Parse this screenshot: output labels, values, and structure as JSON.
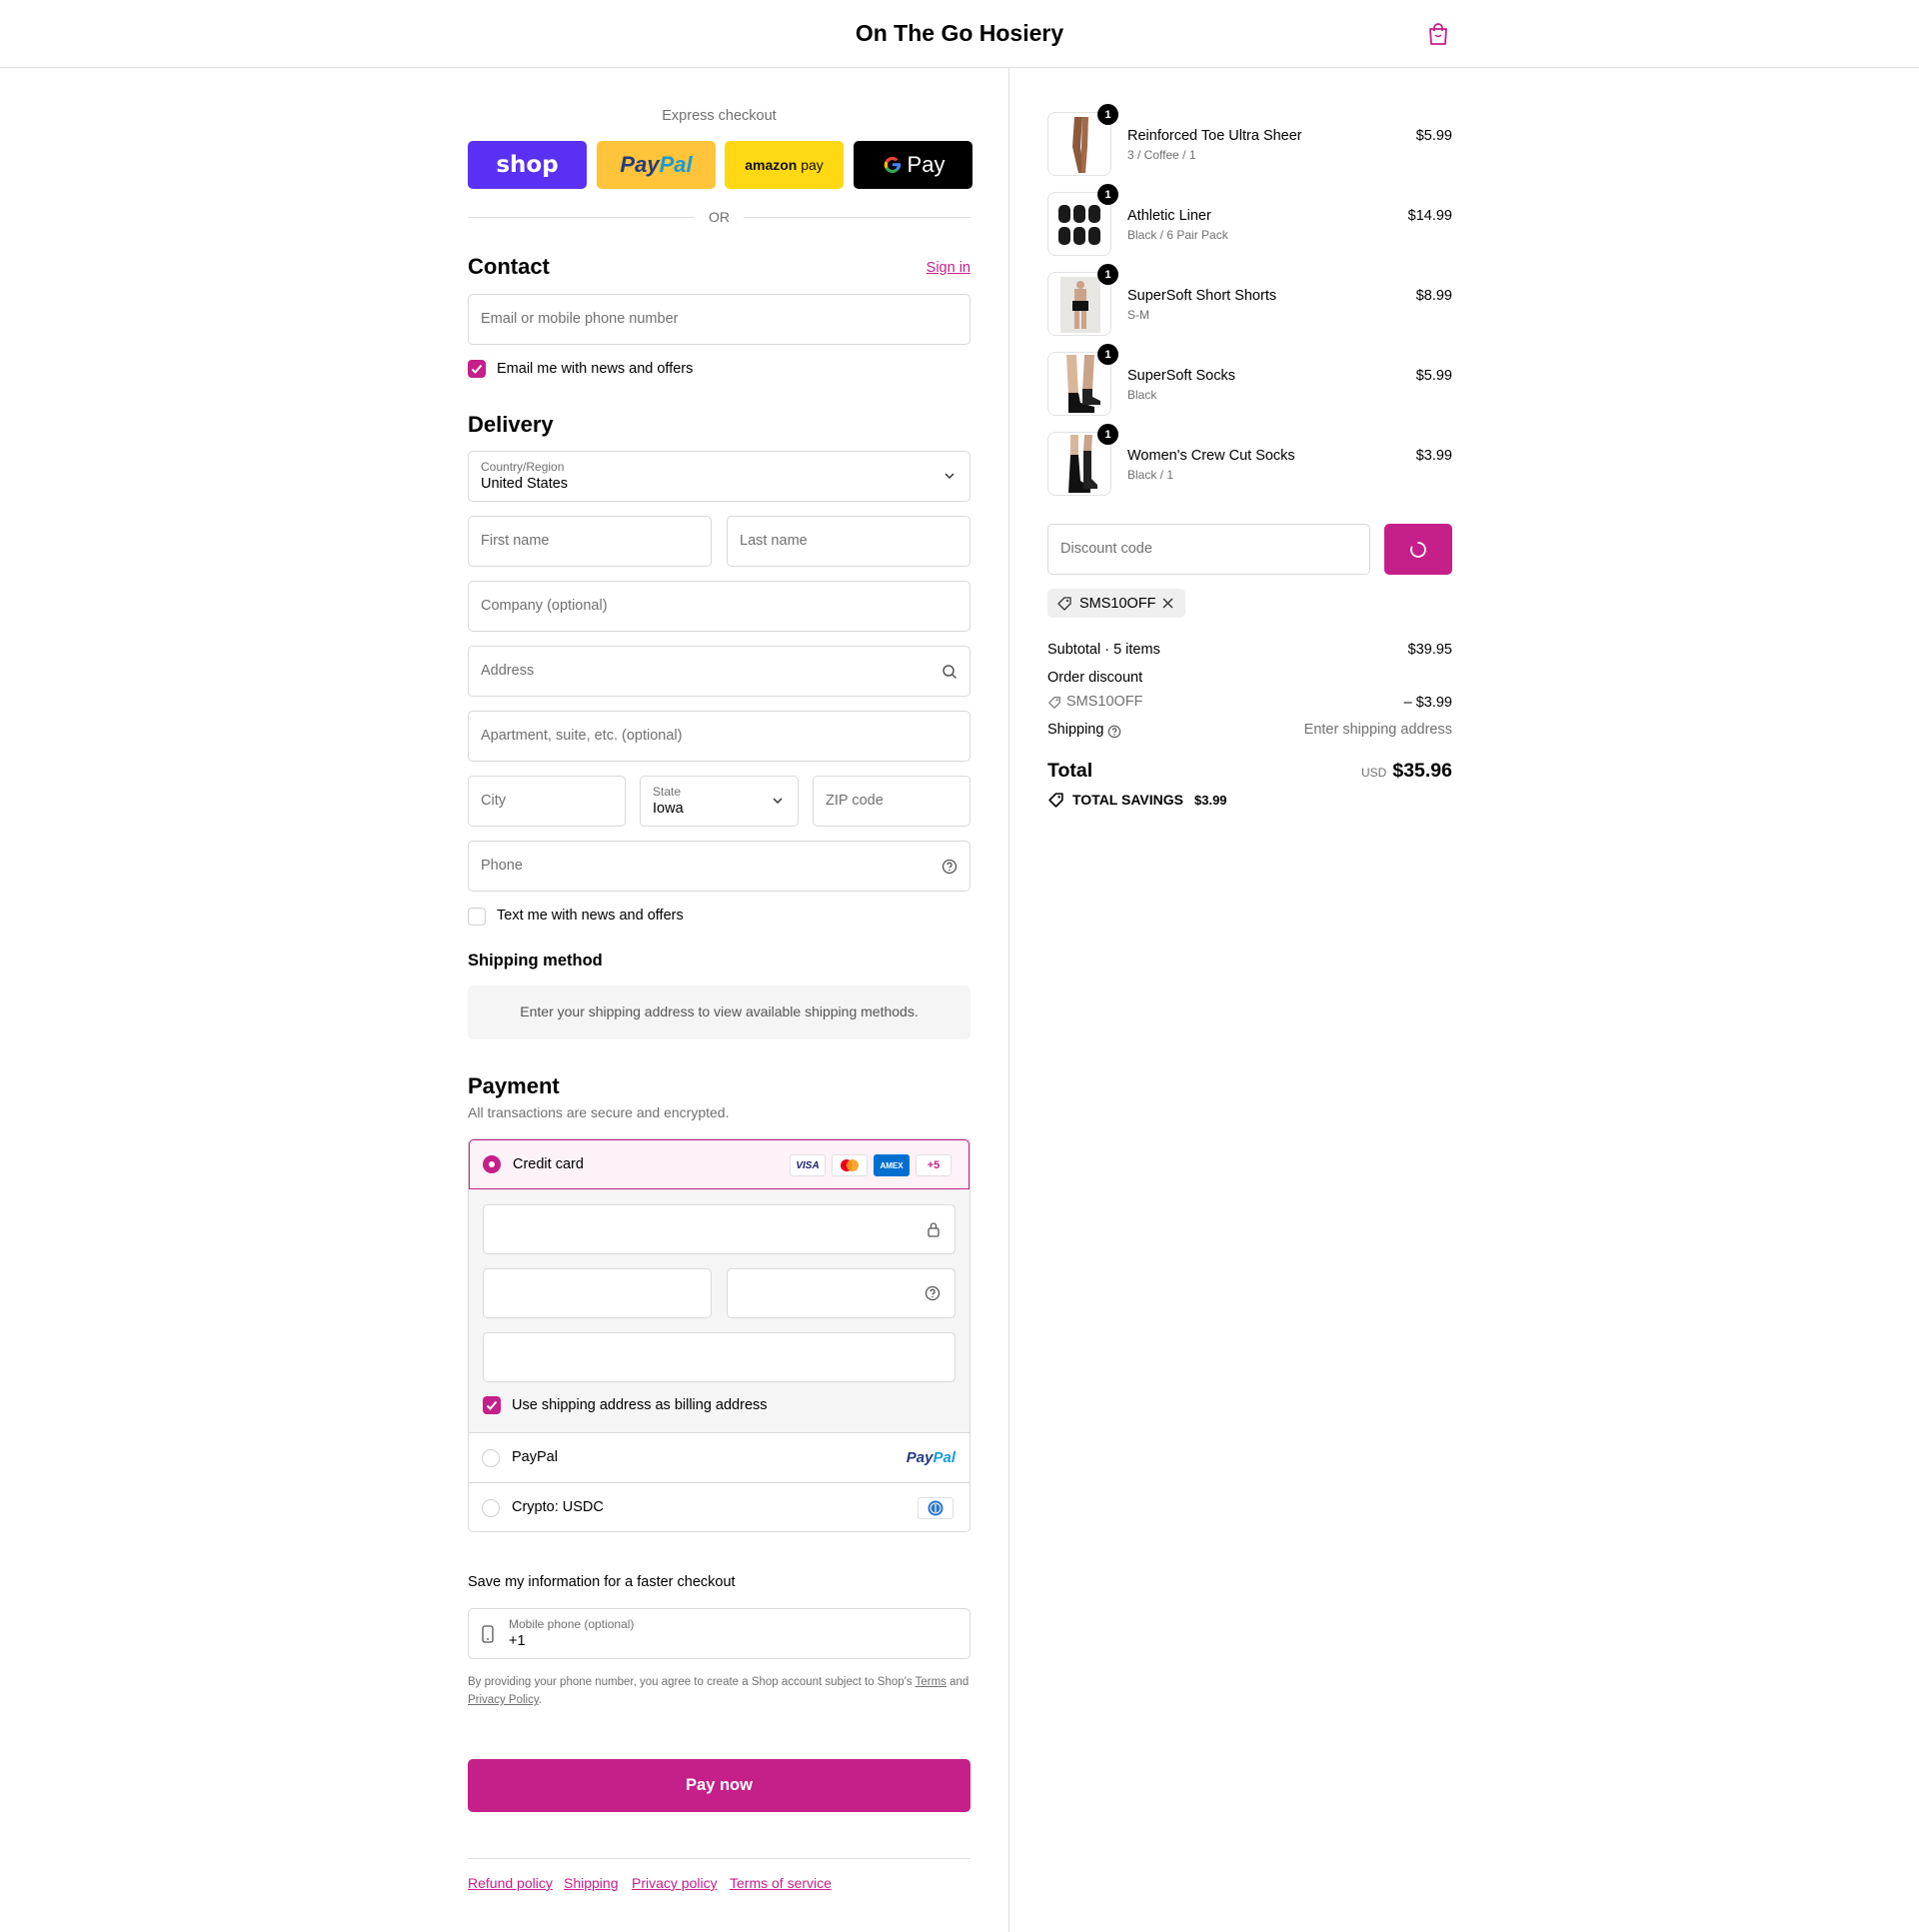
{
  "header": {
    "store_name": "On The Go Hosiery",
    "cart_icon": "shopping-bag-icon"
  },
  "colors": {
    "accent": "#c51f8a",
    "shop_pay": "#5a31f4",
    "paypal": "#ffc439",
    "amazon_pay": "#ffd814",
    "google_pay": "#000000"
  },
  "express": {
    "title": "Express checkout",
    "buttons": {
      "shop": "shop",
      "paypal_pay": "Pay",
      "paypal_pal": "Pal",
      "amazon": "amazon",
      "amazon_pay": "pay",
      "google_pay": "Pay"
    },
    "or_label": "OR"
  },
  "contact": {
    "title": "Contact",
    "sign_in": "Sign in",
    "email_placeholder": "Email or mobile phone number",
    "news_label": "Email me with news and offers"
  },
  "delivery": {
    "title": "Delivery",
    "country_label": "Country/Region",
    "country_value": "United States",
    "first_name": "First name",
    "last_name": "Last name",
    "company": "Company (optional)",
    "address": "Address",
    "apartment": "Apartment, suite, etc. (optional)",
    "city": "City",
    "state_label": "State",
    "state_value": "Iowa",
    "zip": "ZIP code",
    "phone": "Phone",
    "text_label": "Text me with news and offers"
  },
  "shipping_method": {
    "title": "Shipping method",
    "notice": "Enter your shipping address to view available shipping methods."
  },
  "payment": {
    "title": "Payment",
    "subtitle": "All transactions are secure and encrypted.",
    "credit_card": "Credit card",
    "cards": {
      "visa": "VISA",
      "amex": "AMEX",
      "more": "+5"
    },
    "billing_label": "Use shipping address as billing address",
    "paypal": "PayPal",
    "paypal_logo_pay": "Pay",
    "paypal_logo_pal": "Pal",
    "crypto": "Crypto: USDC"
  },
  "save_info": {
    "title": "Save my information for a faster checkout",
    "mobile_label": "Mobile phone (optional)",
    "mobile_value": "+1",
    "legal_prefix": "By providing your phone number, you agree to create a Shop account subject to Shop's",
    "terms": "Terms",
    "and": "and",
    "privacy": "Privacy Policy",
    "period": "."
  },
  "pay_now": "Pay now",
  "footer_links": [
    "Refund policy",
    "Shipping",
    "Privacy policy",
    "Terms of service"
  ],
  "summary": {
    "items": [
      {
        "name": "Reinforced Toe Ultra Sheer",
        "variant": "3 / Coffee / 1",
        "price": "$5.99",
        "qty": "1"
      },
      {
        "name": "Athletic Liner",
        "variant": "Black / 6 Pair Pack",
        "price": "$14.99",
        "qty": "1"
      },
      {
        "name": "SuperSoft Short Shorts",
        "variant": "S-M",
        "price": "$8.99",
        "qty": "1"
      },
      {
        "name": "SuperSoft Socks",
        "variant": "Black",
        "price": "$5.99",
        "qty": "1"
      },
      {
        "name": "Women's Crew Cut Socks",
        "variant": "Black / 1",
        "price": "$3.99",
        "qty": "1"
      }
    ],
    "discount_placeholder": "Discount code",
    "applied_code": "SMS10OFF",
    "subtotal_label": "Subtotal · 5 items",
    "subtotal_value": "$39.95",
    "order_discount_label": "Order discount",
    "discount_code": "SMS10OFF",
    "discount_value": "– $3.99",
    "shipping_label": "Shipping",
    "shipping_value": "Enter shipping address",
    "total_label": "Total",
    "currency": "USD",
    "total_value": "$35.96",
    "savings_label": "TOTAL SAVINGS",
    "savings_value": "$3.99"
  }
}
